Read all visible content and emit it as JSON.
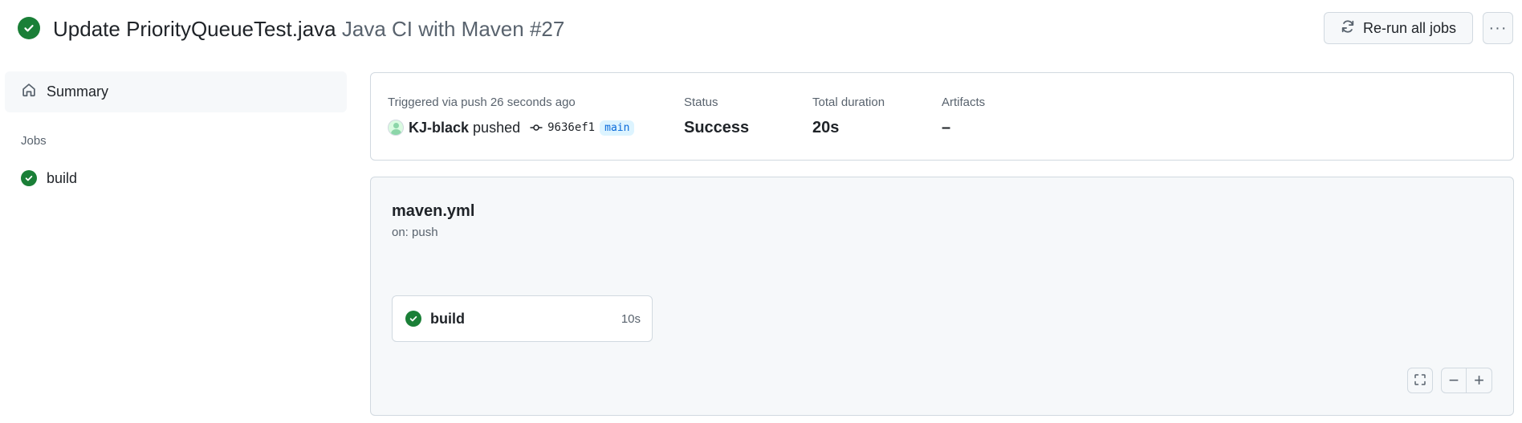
{
  "header": {
    "title": "Update PriorityQueueTest.java",
    "workflow_run": "Java CI with Maven #27",
    "rerun_label": "Re-run all jobs",
    "more_label": "···"
  },
  "sidebar": {
    "summary_label": "Summary",
    "jobs_heading": "Jobs",
    "jobs": [
      {
        "label": "build",
        "status": "success"
      }
    ]
  },
  "info": {
    "trigger_label": "Triggered via push 26 seconds ago",
    "actor": "KJ-black",
    "action": "pushed",
    "commit_sha": "9636ef1",
    "branch": "main",
    "status_label": "Status",
    "status_value": "Success",
    "duration_label": "Total duration",
    "duration_value": "20s",
    "artifacts_label": "Artifacts",
    "artifacts_value": "–"
  },
  "workflow": {
    "file": "maven.yml",
    "trigger": "on: push",
    "job_name": "build",
    "job_duration": "10s"
  },
  "controls": {
    "minus": "−",
    "plus": "+"
  },
  "colors": {
    "success": "#1a7f37",
    "link": "#0969da",
    "muted": "#59636e",
    "border": "#d1d9e0"
  }
}
